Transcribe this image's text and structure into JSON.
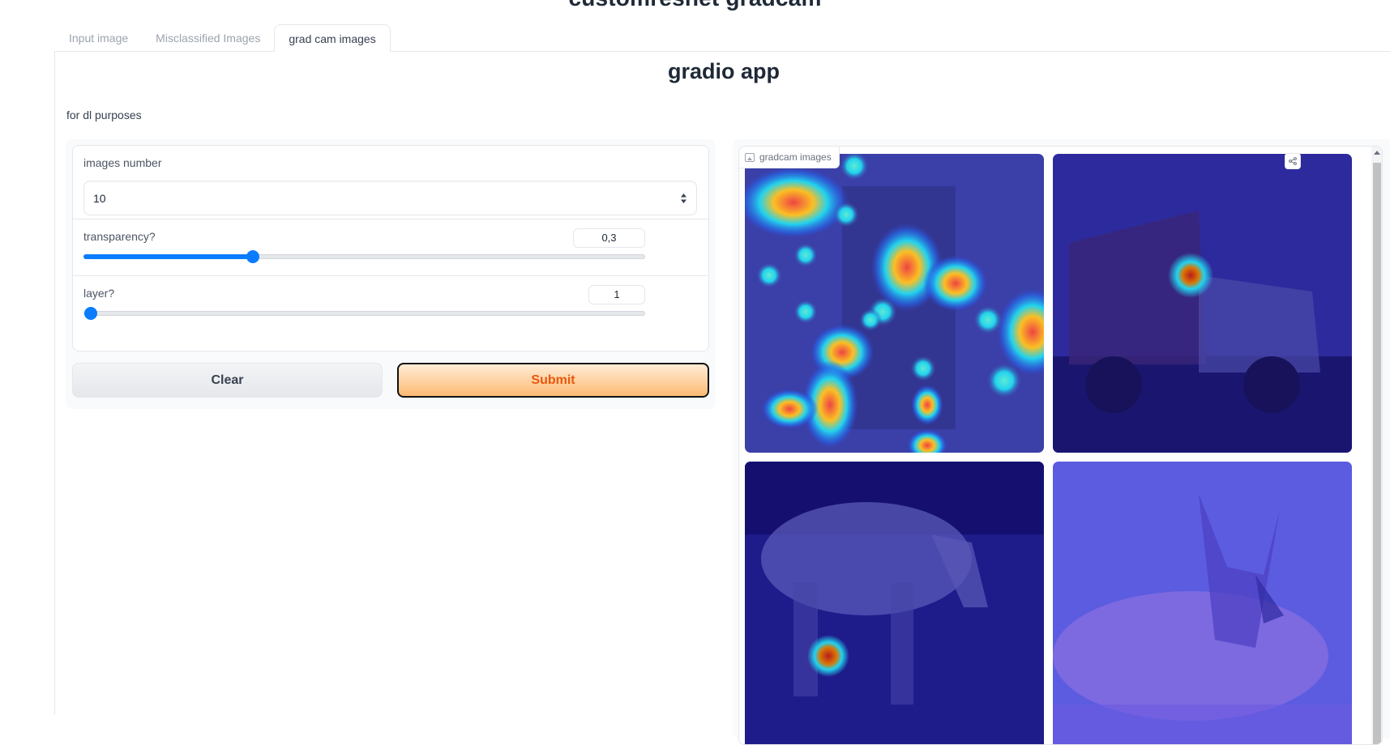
{
  "page": {
    "header_title": "customresnet gradcam"
  },
  "tabs": [
    {
      "label": "Input image",
      "active": false
    },
    {
      "label": "Misclassified Images",
      "active": false
    },
    {
      "label": "grad cam images",
      "active": true
    }
  ],
  "app": {
    "title": "gradio app",
    "description": "for dl purposes"
  },
  "inputs": {
    "images_number": {
      "label": "images number",
      "value": "10"
    },
    "transparency": {
      "label": "transparency?",
      "value": "0,3",
      "fraction": 0.3
    },
    "layer": {
      "label": "layer?",
      "value": "1",
      "fraction": 0.0
    }
  },
  "buttons": {
    "clear_label": "Clear",
    "submit_label": "Submit"
  },
  "gallery": {
    "label": "gradcam images",
    "icon": "image-icon",
    "share_icon": "share-icon"
  },
  "colors": {
    "accent_blue": "#0a7cff",
    "submit_text": "#ea580c",
    "submit_bg_from": "#ffedd5",
    "submit_bg_to": "#fdba74"
  }
}
